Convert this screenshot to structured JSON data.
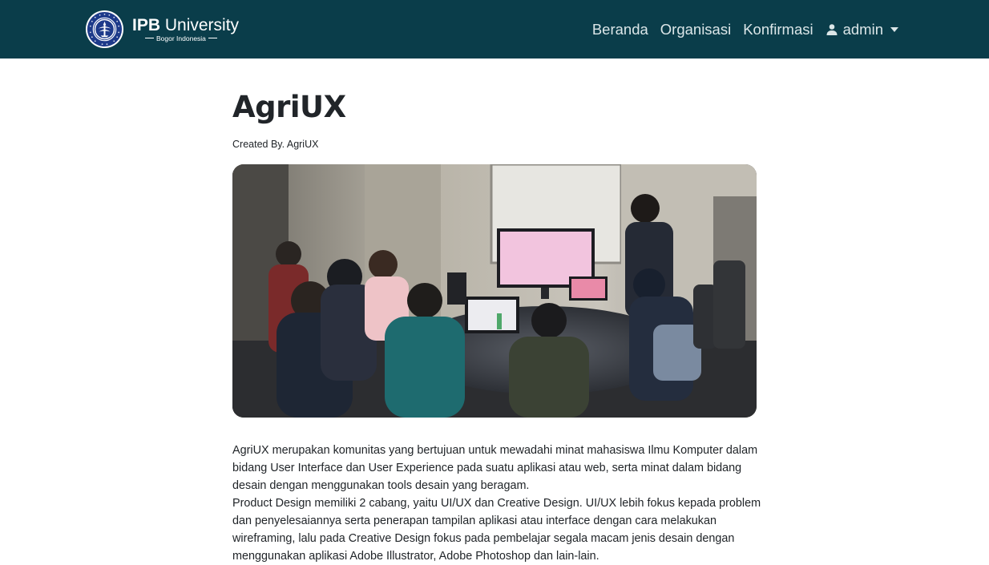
{
  "brand": {
    "name_bold": "IPB",
    "name_rest": " University",
    "subtitle": "Bogor Indonesia"
  },
  "nav": {
    "items": [
      "Beranda",
      "Organisasi",
      "Konfirmasi"
    ],
    "user_label": "admin"
  },
  "page": {
    "title": "AgriUX",
    "author": "Created By. AgriUX",
    "description": [
      "AgriUX merupakan komunitas yang bertujuan untuk mewadahi minat mahasiswa Ilmu Komputer dalam bidang User Interface dan User Experience pada suatu aplikasi atau web, serta minat dalam bidang desain dengan menggunakan tools desain yang beragam.",
      "Product Design memiliki 2 cabang, yaitu UI/UX dan Creative Design. UI/UX lebih fokus kepada problem dan penyelesaiannya serta penerapan tampilan aplikasi atau interface dengan cara melakukan wireframing, lalu pada Creative Design fokus pada pembelajar segala macam jenis desain dengan menggunakan aplikasi Adobe Illustrator, Adobe Photoshop dan lain-lain."
    ]
  },
  "colors": {
    "navbar": "#0a3d4a",
    "nav_text": "#dbe6e8",
    "logo_blue": "#1d3a8a"
  }
}
